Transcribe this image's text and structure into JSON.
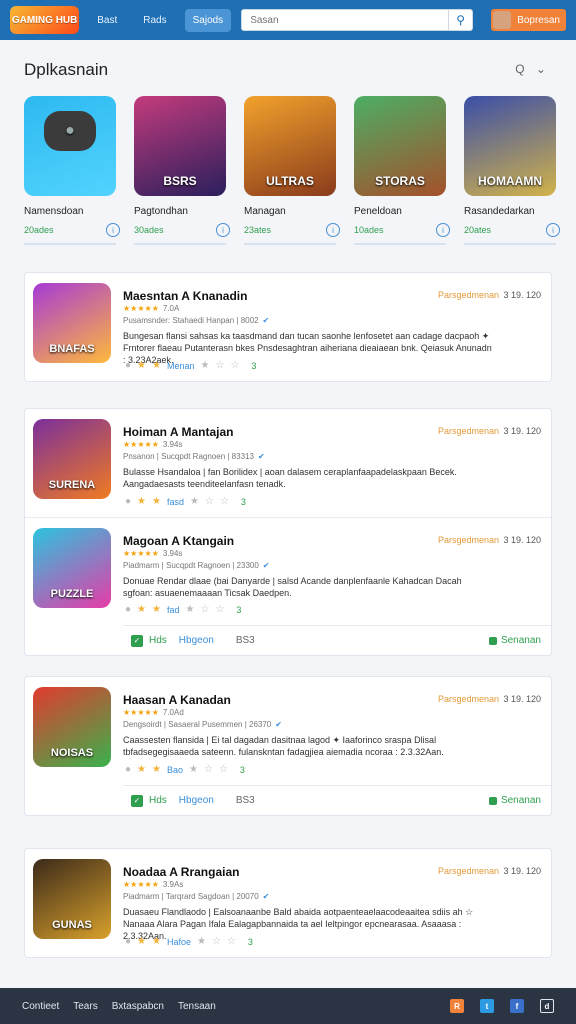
{
  "header": {
    "logo_text": "GAMING HUB",
    "nav": [
      "Bast",
      "Rads",
      "Sajods"
    ],
    "search_placeholder": "Sasan",
    "user_label": "Bopresan"
  },
  "section": {
    "title": "Dplkasnain",
    "tools": "Q ⌄"
  },
  "featured": [
    {
      "name": "Namensdoan",
      "count": "20ades",
      "thumb_text": "",
      "c1": "#2db9ef",
      "c2": "#52d3ff"
    },
    {
      "name": "Pagtondhan",
      "count": "30ades",
      "thumb_text": "BSRS",
      "c1": "#c33b7d",
      "c2": "#2a1f5c"
    },
    {
      "name": "Managan",
      "count": "23ates",
      "thumb_text": "ULTRAS",
      "c1": "#f2a22c",
      "c2": "#8a3b1b"
    },
    {
      "name": "Peneldoan",
      "count": "10ades",
      "thumb_text": "STORAS",
      "c1": "#4cae65",
      "c2": "#a5502b"
    },
    {
      "name": "Rasandedarkan",
      "count": "20ates",
      "thumb_text": "HOMAAMN",
      "c1": "#3a4ea8",
      "c2": "#d2b34a"
    }
  ],
  "apps": [
    {
      "title": "Maesntan A Knanadin",
      "cat": "Parsgedmenan",
      "size": "3 19. 120",
      "rating": "★★★★★",
      "rating_n": "7.0A",
      "dev": "Pusamsnder: Stahaedi Hanpan | 8002",
      "desc": "Bungesan flansi sahsas ka taasdmand dan tucan saonhe lenfosetet aan cadage dacpaoh ✦ Frntorer flaeau Putanterasn bkes Pnsdesaghtran aiheriana dieaiaean bnk. Qeiasuk Anunadn : 3.23A2aek.",
      "icon_text": "BNAFAS",
      "c1": "#a63ad6",
      "c2": "#ffb93b",
      "link": "Menan",
      "cnt": "3"
    },
    {
      "title": "Hoiman A Mantajan",
      "cat": "Parsgedmenan",
      "size": "3 19. 120",
      "rating": "★★★★★",
      "rating_n": "3.94s",
      "dev": "Pnsanon | Sucqpdt Ragnoen | 83313",
      "desc": "Bulasse Hsandaloa | fan Borilidex | aoan dalasem ceraplanfaapadelaskpaan Becek. Aangadaesasts teenditeelanfasn tenadk.",
      "icon_text": "SURENA",
      "c1": "#7b2f9b",
      "c2": "#f07b22",
      "link": "fasd",
      "cnt": "3"
    },
    {
      "title": "Magoan A Ktangain",
      "cat": "Parsgedmenan",
      "size": "3 19. 120",
      "rating": "★★★★★",
      "rating_n": "3.94s",
      "dev": "Piadmarm | Sucqpdt Ragnoen | 23300",
      "desc": "Donuae Rendar dlaae (bai Danyarde | salsd Acande danplenfaanle Kahadcan Dacah sgfoan: asuaenemaaaan Ticsak Daedpen.",
      "icon_text": "PUZZLE",
      "c1": "#2bc4df",
      "c2": "#e73ba7",
      "link": "fad",
      "cnt": "3"
    },
    {
      "title": "Haasan A Kanadan",
      "cat": "Parsgedmenan",
      "size": "3 19. 120",
      "rating": "★★★★★",
      "rating_n": "7.0Ad",
      "dev": "Dengsoirdt | Sasaeral Pusemmen | 26370",
      "desc": "Caassesten flansida | Ei tal dagadan dasitnaa lagod ✦ Iaaforinco sraspa Dlisal tbfadsegegisaaeda sateenn. fulanskntan fadagjiea aiemadia ncoraa : 2.3.32Aan.",
      "icon_text": "NOISAS",
      "c1": "#e23a2e",
      "c2": "#39b24e",
      "link": "Bao",
      "cnt": "3"
    },
    {
      "title": "Noadaa A Rrangaian",
      "cat": "Parsgedmenan",
      "size": "3 19. 120",
      "rating": "★★★★★",
      "rating_n": "3.9As",
      "dev": "Piadmarm | Tarqrard Sagdoan | 20070",
      "desc": "Duasaeu Flandlaodo | Ealsoanaanbe Bald abaida aotpaenteaelaacodeaaitea sdiis ah ☆ Nanaaa Alara Pagan Ifala Ealagapbannaida ta ael Ieltpingor epcnearasaa. Asaaasa : 2.3.32Aan.",
      "icon_text": "GUNAS",
      "c1": "#3b2a1a",
      "c2": "#d9a12c",
      "link": "Hafoe",
      "cnt": "3"
    }
  ],
  "strips": [
    {
      "a": "Hds",
      "b": "Hbgeon",
      "c": "BS3",
      "d": "Senanan"
    },
    {
      "a": "Hds",
      "b": "Hbgeon",
      "c": "BS3",
      "d": "Senanan"
    }
  ],
  "footer": {
    "links": [
      "Contieet",
      "Tears",
      "Bxtaspabcn",
      "Tensaan"
    ],
    "social": [
      {
        "name": "rss",
        "color": "#f0823a",
        "glyph": "R"
      },
      {
        "name": "twitter",
        "color": "#2d9be4",
        "glyph": "t"
      },
      {
        "name": "facebook",
        "color": "#3a70c9",
        "glyph": "f"
      },
      {
        "name": "discord",
        "color": "#2a3443",
        "glyph": "d"
      }
    ]
  }
}
